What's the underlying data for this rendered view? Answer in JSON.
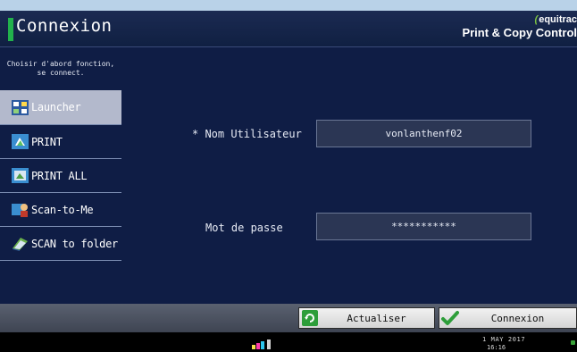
{
  "header": {
    "title": "Connexion",
    "brand_name": "equitrac",
    "brand_tagline": "Print & Copy Control"
  },
  "sidebar": {
    "hint_line1": "Choisir d'abord fonction,",
    "hint_line2": "se connect.",
    "items": [
      {
        "label": "Launcher",
        "icon": "launcher-icon",
        "selected": true
      },
      {
        "label": "PRINT",
        "icon": "print-icon"
      },
      {
        "label": "PRINT ALL",
        "icon": "print-all-icon"
      },
      {
        "label": "Scan-to-Me",
        "icon": "scan-to-me-icon"
      },
      {
        "label": "SCAN to folder",
        "icon": "scan-to-folder-icon"
      }
    ]
  },
  "form": {
    "username_label": "* Nom Utilisateur",
    "username_value": "vonlanthenf02",
    "password_label": "Mot de passe",
    "password_value": "***********"
  },
  "actions": {
    "refresh_label": "Actualiser",
    "login_label": "Connexion"
  },
  "status": {
    "date": "1 MAY  2017",
    "time": "16:16"
  },
  "colors": {
    "panel_bg": "#0f1d45",
    "accent_green": "#22b14c",
    "selected_item": "#b3b9cc"
  }
}
